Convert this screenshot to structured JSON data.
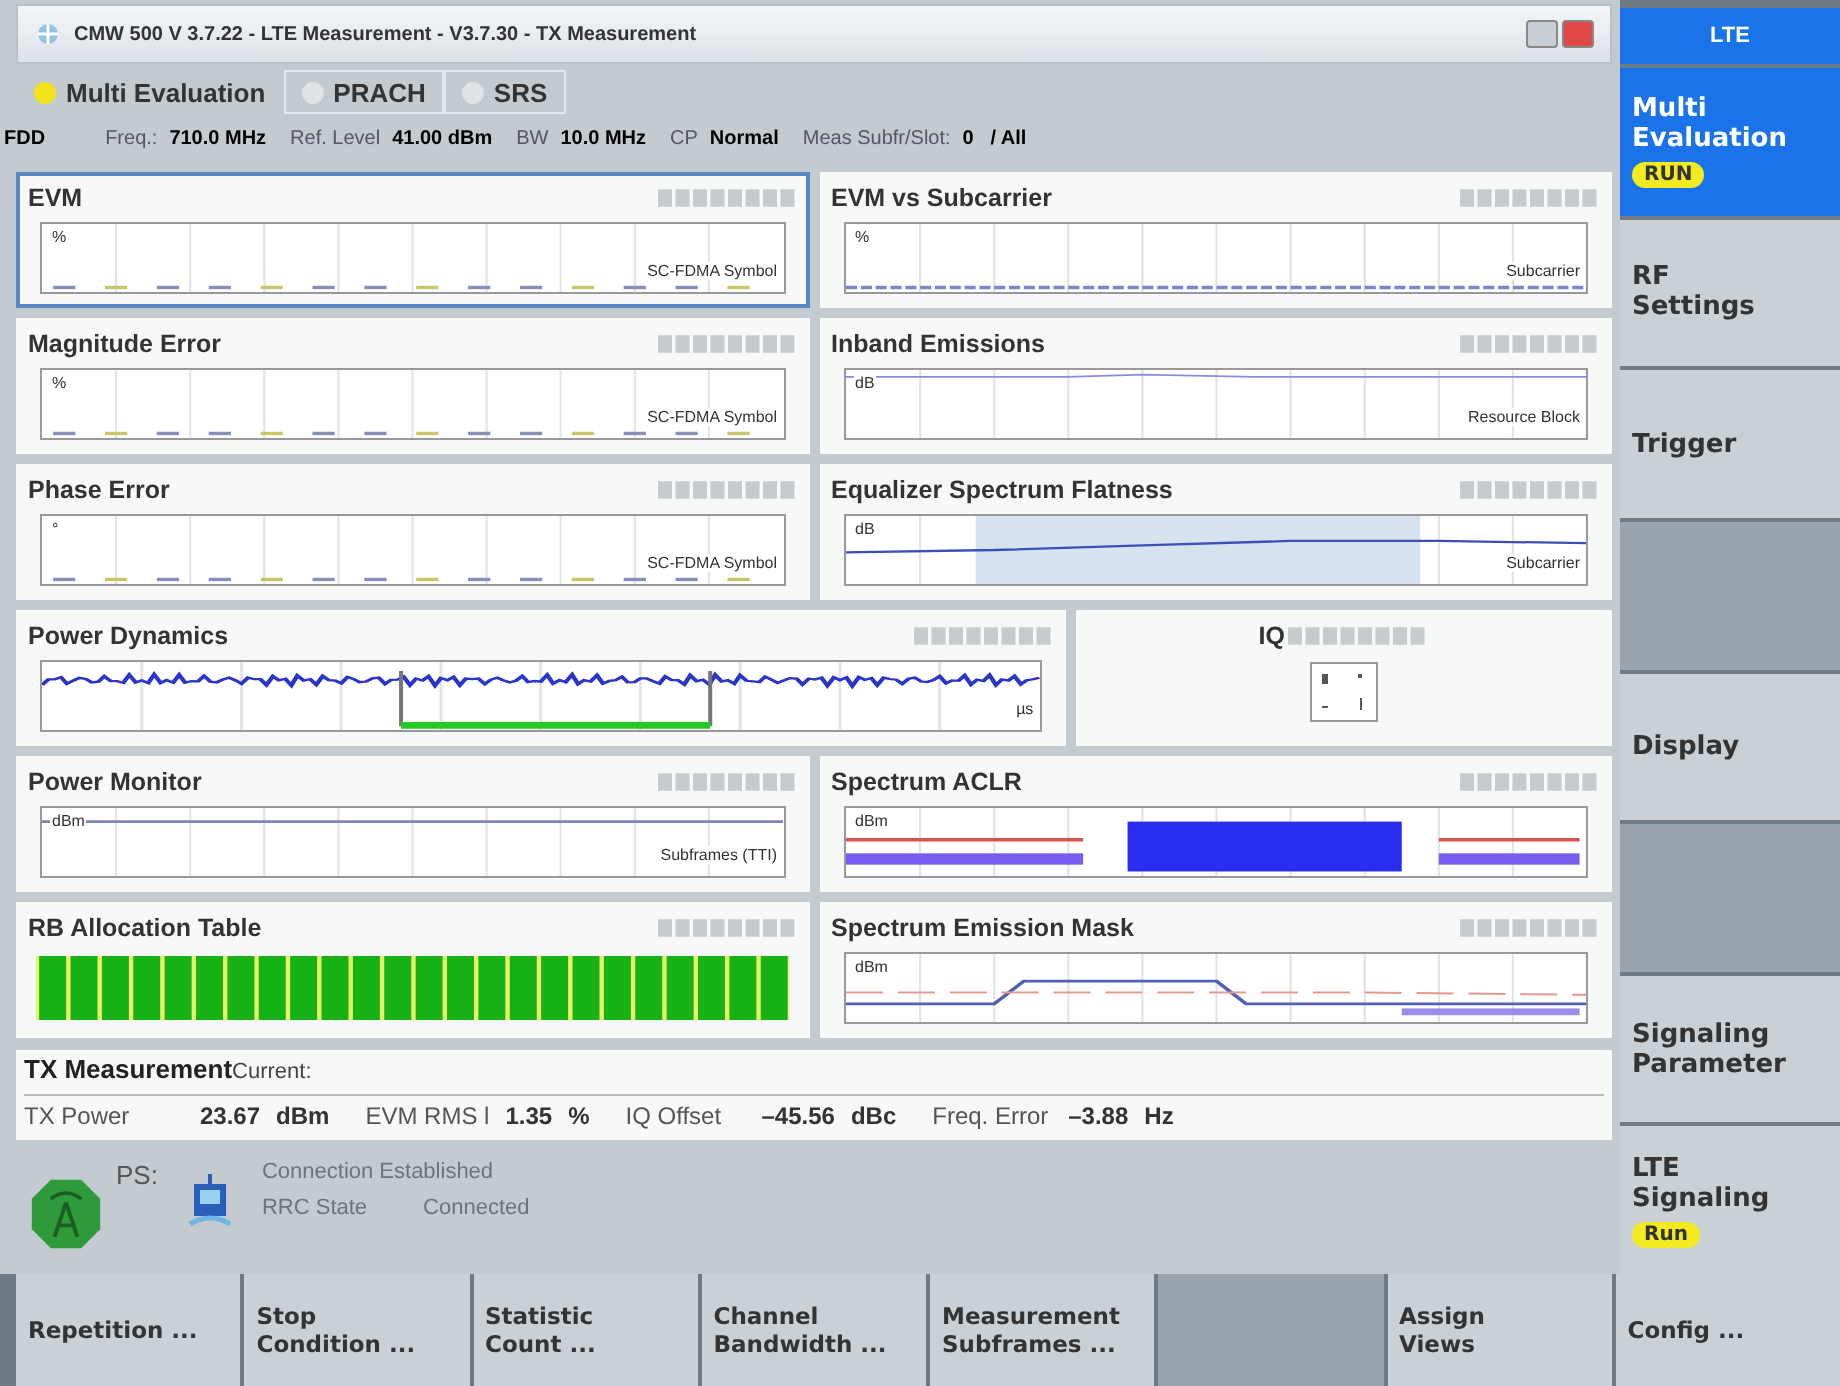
{
  "window": {
    "title": "CMW 500 V 3.7.22 - LTE Measurement  - V3.7.30 - TX Measurement"
  },
  "tabs": [
    {
      "label": "Multi Evaluation",
      "selected": true
    },
    {
      "label": "PRACH",
      "selected": false
    },
    {
      "label": "SRS",
      "selected": false
    }
  ],
  "info_line": {
    "duplex": "FDD",
    "fields": [
      {
        "label": "Freq.:",
        "value": "710.0 MHz"
      },
      {
        "label": "Ref. Level",
        "value": "41.00 dBm"
      },
      {
        "label": "BW",
        "value": "10.0 MHz"
      },
      {
        "label": "CP",
        "value": "Normal"
      },
      {
        "label": "Meas Subfr/Slot:",
        "value": "0   / All"
      }
    ]
  },
  "panels": [
    [
      {
        "title": "EVM",
        "selected": true,
        "kind": "symbol-dots",
        "unit": "%",
        "xlabel": "SC-FDMA Symbol"
      },
      {
        "title": "EVM vs Subcarrier",
        "selected": false,
        "kind": "flat",
        "unit": "%",
        "xlabel": "Subcarrier"
      }
    ],
    [
      {
        "title": "Magnitude Error",
        "selected": false,
        "kind": "symbol-dots",
        "unit": "%",
        "xlabel": "SC-FDMA Symbol"
      },
      {
        "title": "Inband Emissions",
        "selected": false,
        "kind": "inband",
        "unit": "dB",
        "xlabel": "Resource Block"
      }
    ],
    [
      {
        "title": "Phase Error",
        "selected": false,
        "kind": "symbol-dots",
        "unit": "°",
        "xlabel": "SC-FDMA Symbol"
      },
      {
        "title": "Equalizer Spectrum Flatness",
        "selected": false,
        "kind": "flatness",
        "unit": "dB",
        "xlabel": "Subcarrier"
      }
    ],
    [
      {
        "title": "Power Dynamics",
        "selected": false,
        "kind": "power-dynamics",
        "xlabel": "µs"
      },
      {
        "title": "IQ",
        "selected": false,
        "kind": "iq"
      }
    ],
    [
      {
        "title": "Power Monitor",
        "selected": false,
        "kind": "power-monitor",
        "unit": "dBm",
        "xlabel": "Subframes (TTI)"
      },
      {
        "title": "Spectrum ACLR",
        "selected": false,
        "kind": "aclr",
        "unit": "dBm"
      }
    ],
    [
      {
        "title": "RB Allocation Table",
        "selected": false,
        "kind": "rb-grid"
      },
      {
        "title": "Spectrum Emission Mask",
        "selected": false,
        "kind": "sem",
        "unit": "dBm"
      }
    ]
  ],
  "tx_measurement": {
    "title": "TX Measurement",
    "subtitle": "Current:",
    "results": [
      {
        "label": "TX Power",
        "value": "23.67",
        "unit": "dBm"
      },
      {
        "label": "EVM RMS l",
        "value": "1.35",
        "unit": "%"
      },
      {
        "label": "IQ Offset",
        "value": "–45.56",
        "unit": "dBc"
      },
      {
        "label": "Freq. Error",
        "value": "–3.88",
        "unit": "Hz"
      }
    ]
  },
  "status": {
    "ps_label": "PS:",
    "connection": "Connection Established",
    "rrc_label": "RRC State",
    "rrc_value": "Connected"
  },
  "sidebar": {
    "header": "LTE",
    "items": [
      {
        "kind": "softkey",
        "label": "Multi\nEvaluation",
        "badge": "RUN",
        "selected": true
      },
      {
        "kind": "softkey",
        "label": "RF\nSettings",
        "selected": false
      },
      {
        "kind": "softkey",
        "label": "Trigger",
        "selected": false
      },
      {
        "kind": "blank"
      },
      {
        "kind": "softkey",
        "label": "Display",
        "selected": false
      },
      {
        "kind": "blank"
      },
      {
        "kind": "softkey",
        "label": "Signaling\nParameter",
        "selected": false
      },
      {
        "kind": "softkey",
        "label": "LTE\nSignaling",
        "badge": "Run",
        "selected": false
      }
    ]
  },
  "softkeys": [
    {
      "kind": "softkey",
      "label": "Repetition ..."
    },
    {
      "kind": "softkey",
      "label": "Stop\nCondition ..."
    },
    {
      "kind": "softkey",
      "label": "Statistic\nCount ..."
    },
    {
      "kind": "softkey",
      "label": "Channel\nBandwidth ..."
    },
    {
      "kind": "softkey",
      "label": "Measurement\nSubframes ..."
    },
    {
      "kind": "blank"
    },
    {
      "kind": "softkey",
      "label": "Assign\nViews"
    },
    {
      "kind": "softkey",
      "label": "Config ..."
    }
  ]
}
